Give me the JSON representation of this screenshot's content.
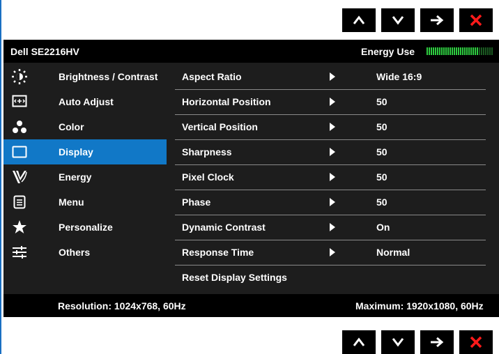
{
  "nav": {
    "buttons": [
      "up-icon",
      "down-icon",
      "right-arrow-icon",
      "close-icon"
    ],
    "close_color": "#ff1a1a"
  },
  "header": {
    "model": "Dell SE2216HV",
    "energy_label": "Energy Use",
    "energy_level": 0.78
  },
  "menu": {
    "items": [
      {
        "label": "Brightness / Contrast",
        "icon": "brightness-icon"
      },
      {
        "label": "Auto Adjust",
        "icon": "auto-adjust-icon"
      },
      {
        "label": "Color",
        "icon": "color-icon"
      },
      {
        "label": "Display",
        "icon": "display-icon"
      },
      {
        "label": "Energy",
        "icon": "energy-icon"
      },
      {
        "label": "Menu",
        "icon": "menu-icon"
      },
      {
        "label": "Personalize",
        "icon": "star-icon"
      },
      {
        "label": "Others",
        "icon": "sliders-icon"
      }
    ],
    "active": "Display"
  },
  "settings": [
    {
      "name": "Aspect Ratio",
      "value": "Wide 16:9"
    },
    {
      "name": "Horizontal Position",
      "value": "50"
    },
    {
      "name": "Vertical Position",
      "value": "50"
    },
    {
      "name": "Sharpness",
      "value": "50"
    },
    {
      "name": "Pixel Clock",
      "value": "50"
    },
    {
      "name": "Phase",
      "value": "50"
    },
    {
      "name": "Dynamic Contrast",
      "value": "On"
    },
    {
      "name": "Response Time",
      "value": "Normal"
    },
    {
      "name": "Reset Display Settings",
      "value": ""
    }
  ],
  "footer": {
    "resolution": "Resolution: 1024x768, 60Hz",
    "maximum": "Maximum: 1920x1080, 60Hz"
  },
  "colors": {
    "accent": "#1178c7",
    "energy_green": "#2ecc40",
    "panel": "#1d1d1d"
  }
}
